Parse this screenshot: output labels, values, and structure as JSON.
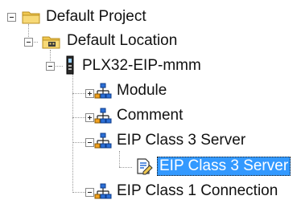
{
  "tree": {
    "project": {
      "label": "Default Project",
      "expanded": true,
      "icon": "folder-icon"
    },
    "location": {
      "label": "Default Location",
      "expanded": true,
      "icon": "location-folder-icon"
    },
    "device": {
      "label": "PLX32-EIP-mmm",
      "expanded": true,
      "icon": "device-icon"
    },
    "children": [
      {
        "label": "Module",
        "expanded": false,
        "icon": "network-node-icon"
      },
      {
        "label": "Comment",
        "expanded": false,
        "icon": "network-node-icon"
      },
      {
        "label": "EIP Class 3 Server",
        "expanded": true,
        "icon": "network-node-icon"
      },
      {
        "label": "EIP Class 1 Connection",
        "expanded": true,
        "icon": "network-node-icon"
      }
    ],
    "selected_item": {
      "label": "EIP Class 3 Server",
      "icon": "edit-document-icon",
      "selected": true
    }
  },
  "colors": {
    "selection": "#3399ff",
    "folder": "#f0c850",
    "node": "#2b6fd6"
  }
}
